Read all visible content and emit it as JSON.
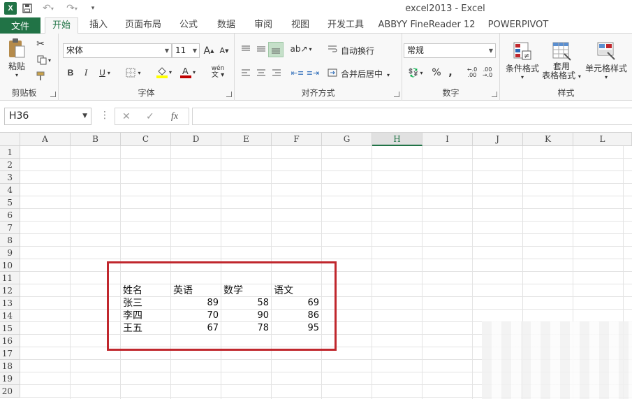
{
  "window": {
    "title": "excel2013 - Excel",
    "logo_letter": "X"
  },
  "qat": {
    "save": "💾",
    "undo": "↶",
    "redo": "↷",
    "more": "▾"
  },
  "tabs": {
    "file": "文件",
    "items": [
      {
        "label": "开始",
        "active": true
      },
      {
        "label": "插入"
      },
      {
        "label": "页面布局"
      },
      {
        "label": "公式"
      },
      {
        "label": "数据"
      },
      {
        "label": "审阅"
      },
      {
        "label": "视图"
      },
      {
        "label": "开发工具"
      },
      {
        "label": "ABBYY FineReader 12"
      },
      {
        "label": "POWERPIVOT"
      }
    ]
  },
  "ribbon": {
    "clipboard": {
      "label": "剪贴板",
      "paste": "粘贴"
    },
    "font": {
      "label": "字体",
      "font_name": "宋体",
      "font_size": "11",
      "grow": "A",
      "shrink": "A",
      "bold": "B",
      "italic": "I",
      "underline": "U",
      "phonetic": "wén"
    },
    "alignment": {
      "label": "对齐方式",
      "wrap_text": "自动换行",
      "merge_center": "合并后居中"
    },
    "number": {
      "label": "数字",
      "format": "常规",
      "percent": "%",
      "comma": ","
    },
    "styles": {
      "label": "样式",
      "conditional": "条件格式",
      "table_format_line1": "套用",
      "table_format_line2": "表格格式",
      "cell_styles": "单元格样式"
    }
  },
  "formula_bar": {
    "name_box": "H36",
    "fx": "fx",
    "cancel": "✕",
    "enter": "✓",
    "value": ""
  },
  "grid": {
    "columns": [
      "A",
      "B",
      "C",
      "D",
      "E",
      "F",
      "G",
      "H",
      "I",
      "J",
      "K",
      "L"
    ],
    "selected_column": "H",
    "rows": [
      "1",
      "2",
      "3",
      "4",
      "5",
      "6",
      "7",
      "8",
      "9",
      "10",
      "11",
      "12",
      "13",
      "14",
      "15",
      "16",
      "17",
      "18",
      "19",
      "20"
    ],
    "table": {
      "header": [
        "姓名",
        "英语",
        "数学",
        "语文"
      ],
      "rows": [
        [
          "张三",
          "89",
          "58",
          "69"
        ],
        [
          "李四",
          "70",
          "90",
          "86"
        ],
        [
          "王五",
          "67",
          "78",
          "95"
        ]
      ]
    }
  },
  "colors": {
    "excel_green": "#217346",
    "highlight_red": "#c0272d"
  }
}
